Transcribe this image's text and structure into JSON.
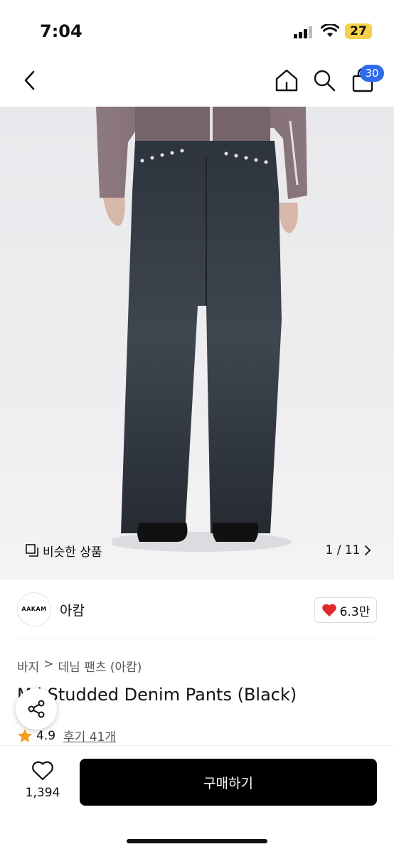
{
  "status_bar": {
    "time": "7:04",
    "battery": "27"
  },
  "header": {
    "cart_count": "30"
  },
  "gallery": {
    "similar_label": "비슷한 상품",
    "page_indicator": "1 / 11"
  },
  "brand": {
    "logo_text": "AAKAM",
    "name": "아캄",
    "likes": "6.3만"
  },
  "breadcrumb": [
    "바지",
    "데님 팬츠 (아캄)"
  ],
  "product": {
    "title": "M  i Studded Denim Pants (Black)",
    "rating": "4.9",
    "reviews": "후기 41개"
  },
  "bottom_bar": {
    "wish_count": "1,394",
    "buy_label": "구매하기"
  },
  "colors": {
    "accent": "#2f6bef",
    "heart": "#e0292f",
    "star": "#f29b1d",
    "buy": "#000000"
  }
}
